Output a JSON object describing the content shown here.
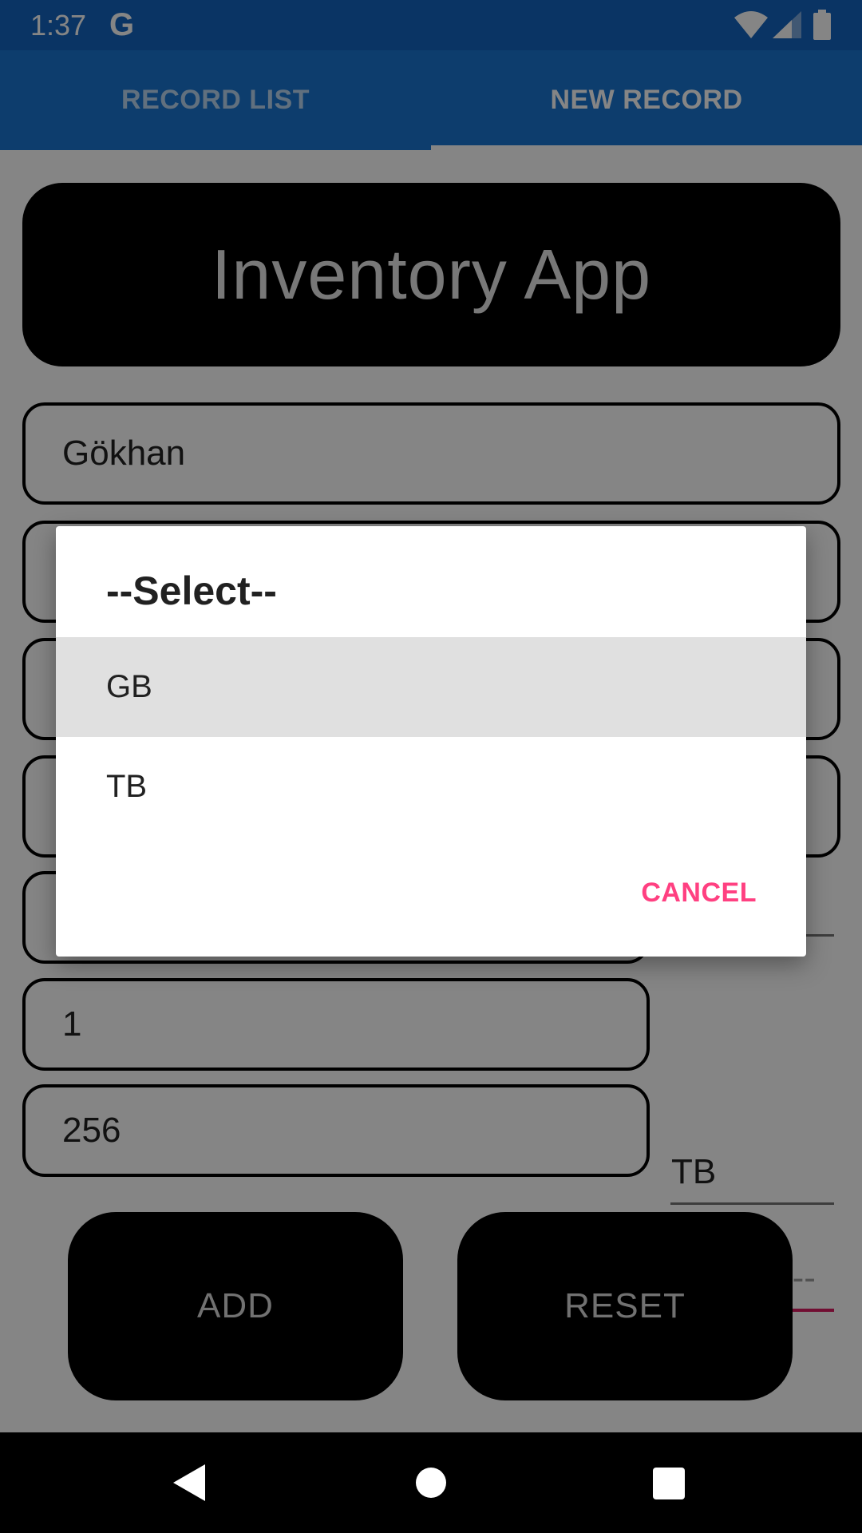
{
  "status_bar": {
    "time": "1:37",
    "notification": "G"
  },
  "tabs": [
    {
      "label": "RECORD LIST",
      "selected": false
    },
    {
      "label": "NEW RECORD",
      "selected": true
    }
  ],
  "header": {
    "title": "Inventory App"
  },
  "form": {
    "fields": [
      {
        "value": "Gökhan"
      },
      {
        "value": ""
      },
      {
        "value": ""
      },
      {
        "value": ""
      },
      {
        "value": ""
      },
      {
        "value": "1",
        "unit": "TB"
      },
      {
        "value": "256",
        "unit": "--Select--"
      }
    ]
  },
  "buttons": {
    "add": "ADD",
    "reset": "RESET"
  },
  "dialog": {
    "title": "--Select--",
    "options": [
      "GB",
      "TB"
    ],
    "cancel": "CANCEL"
  },
  "colors": {
    "primary": "#1976d2",
    "primary_dark": "#1565c0",
    "accent": "#ff4081",
    "spinner_underline_active": "#d81b60"
  },
  "icons": [
    "wifi-icon",
    "signal-icon",
    "battery-icon",
    "back-icon",
    "home-icon",
    "recents-icon"
  ]
}
